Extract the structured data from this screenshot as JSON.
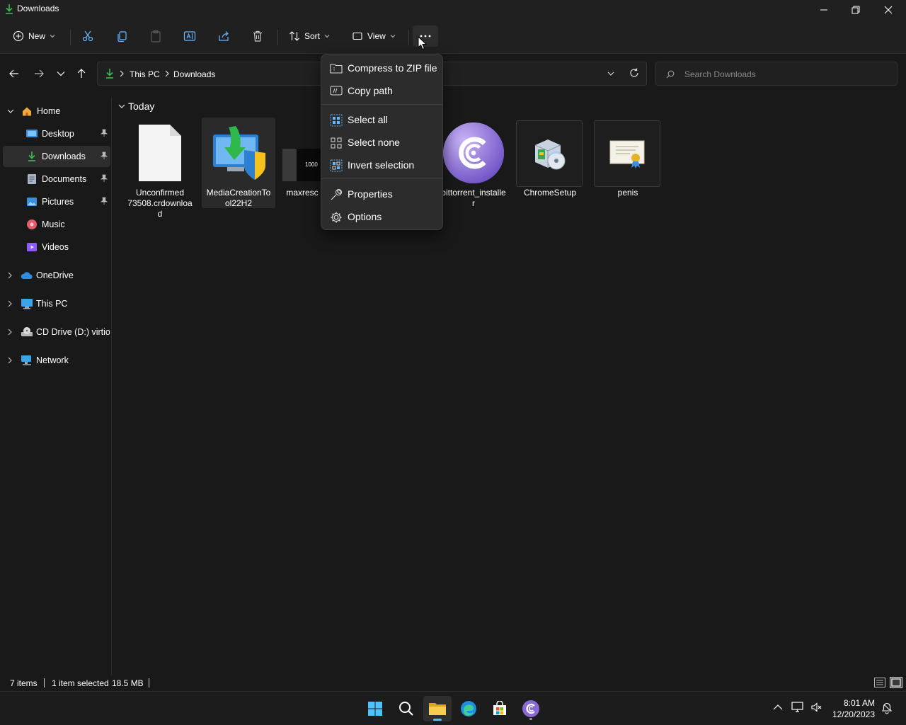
{
  "window": {
    "title": "Downloads"
  },
  "toolbar": {
    "new_label": "New",
    "sort_label": "Sort",
    "view_label": "View"
  },
  "address": {
    "crumbs": [
      "This PC",
      "Downloads"
    ]
  },
  "search": {
    "placeholder": "Search Downloads"
  },
  "sidebar": {
    "items": [
      {
        "label": "Home",
        "icon": "home-icon"
      },
      {
        "label": "Desktop",
        "icon": "desktop-icon",
        "pinned": true
      },
      {
        "label": "Downloads",
        "icon": "downloads-icon",
        "pinned": true,
        "selected": true
      },
      {
        "label": "Documents",
        "icon": "documents-icon",
        "pinned": true
      },
      {
        "label": "Pictures",
        "icon": "pictures-icon",
        "pinned": true
      },
      {
        "label": "Music",
        "icon": "music-icon"
      },
      {
        "label": "Videos",
        "icon": "videos-icon"
      },
      {
        "label": "OneDrive",
        "icon": "onedrive-icon"
      },
      {
        "label": "This PC",
        "icon": "pc-icon"
      },
      {
        "label": "CD Drive (D:) virtio-w",
        "icon": "cd-drive-icon"
      },
      {
        "label": "Network",
        "icon": "network-icon"
      }
    ]
  },
  "content": {
    "group_label": "Today",
    "files": [
      {
        "name": "Unconfirmed 73508.crdownload",
        "lines": [
          "Unconfirmed",
          "73508.crdownloa",
          "d"
        ],
        "icon": "blank-file-icon"
      },
      {
        "name": "MediaCreationTool22H2",
        "lines": [
          "MediaCreationTo",
          "ol22H2"
        ],
        "icon": "media-creation-tool-icon",
        "selected": true
      },
      {
        "name": "maxresdefault",
        "lines": [
          "maxresc"
        ],
        "icon": "image-thumbnail-icon",
        "thumb_text": "1000"
      },
      {
        "name": "bittorrent_installer",
        "lines": [
          "bittorrent_installe",
          "r"
        ],
        "icon": "bittorrent-icon"
      },
      {
        "name": "ChromeSetup",
        "lines": [
          "ChromeSetup"
        ],
        "icon": "installer-icon"
      },
      {
        "name": "penis",
        "lines": [
          "penis"
        ],
        "icon": "certificate-icon"
      }
    ]
  },
  "menu": {
    "items": [
      {
        "label": "Compress to ZIP file",
        "icon": "zip-icon"
      },
      {
        "label": "Copy path",
        "icon": "copy-path-icon"
      },
      {
        "label": "Select all",
        "icon": "select-all-icon"
      },
      {
        "label": "Select none",
        "icon": "select-none-icon"
      },
      {
        "label": "Invert selection",
        "icon": "invert-selection-icon"
      },
      {
        "label": "Properties",
        "icon": "properties-icon"
      },
      {
        "label": "Options",
        "icon": "options-icon"
      }
    ]
  },
  "status": {
    "items_count": "7 items",
    "selection": "1 item selected",
    "size": "18.5 MB"
  },
  "taskbar": {
    "time": "8:01 AM",
    "date": "12/20/2023"
  },
  "colors": {
    "accent": "#4cc2ff",
    "background": "#191919",
    "menu_bg": "#2c2c2c"
  }
}
